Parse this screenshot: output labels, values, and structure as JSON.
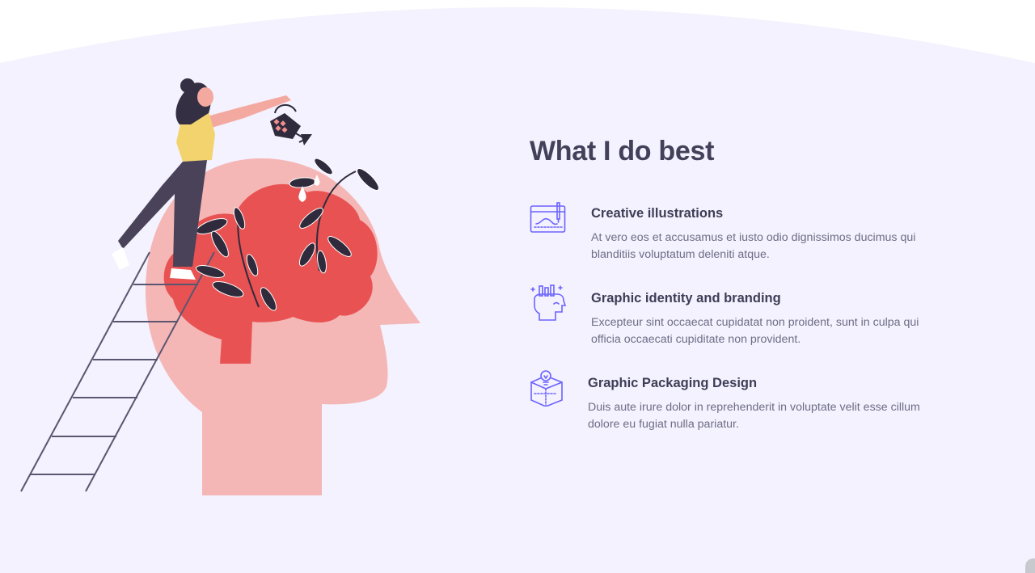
{
  "section": {
    "title": "What I do best"
  },
  "services": [
    {
      "icon": "design-tools-monitor-icon",
      "title": "Creative illustrations",
      "description": "At vero eos et accusamus et iusto odio dignissimos ducimus qui blanditiis voluptatum deleniti atque."
    },
    {
      "icon": "head-ideas-icon",
      "title": "Graphic identity and branding",
      "description": "Excepteur sint occaecat cupidatat non proident, sunt in culpa qui officia occaecati cupiditate non provident."
    },
    {
      "icon": "lightbulb-box-icon",
      "title": "Graphic Packaging Design",
      "description": "Duis aute irure dolor in reprehenderit in voluptate velit esse cillum dolore eu fugiat nulla pariatur."
    }
  ],
  "colors": {
    "background_tint": "#f3f2fe",
    "heading": "#434059",
    "body_text": "#6f6c86",
    "icon_accent": "#6c63ff",
    "head_pink": "#f5b6b6",
    "brain_red": "#e85252"
  }
}
